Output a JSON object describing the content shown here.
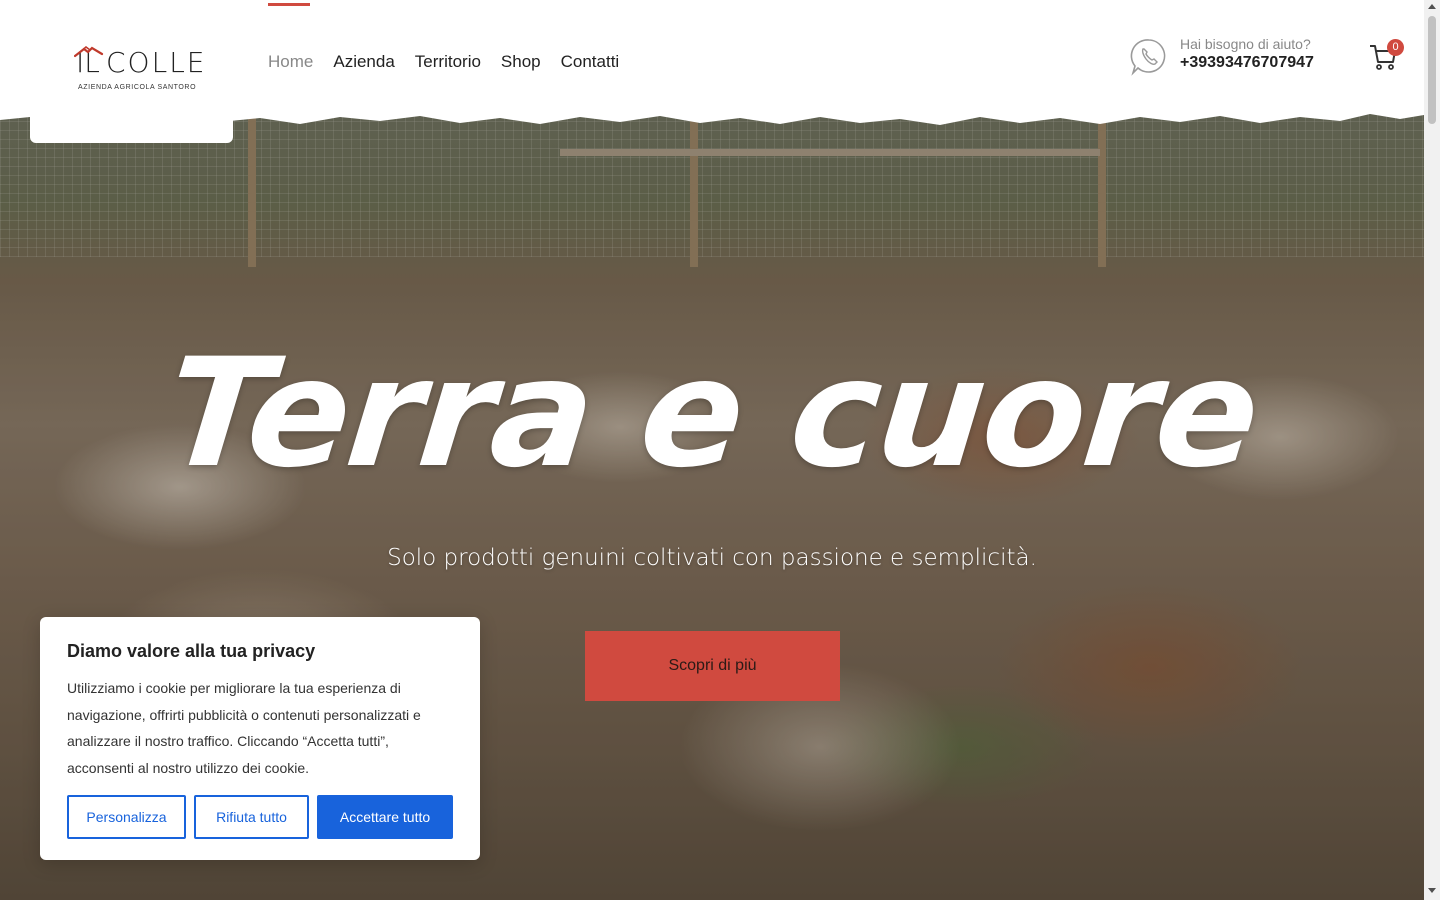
{
  "brand": {
    "name_left": "IL",
    "name_right": "COLLE",
    "tagline": "AZIENDA AGRICOLA SANTORO"
  },
  "nav": {
    "items": [
      {
        "label": "Home",
        "active": true
      },
      {
        "label": "Azienda",
        "active": false
      },
      {
        "label": "Territorio",
        "active": false
      },
      {
        "label": "Shop",
        "active": false
      },
      {
        "label": "Contatti",
        "active": false
      }
    ]
  },
  "help": {
    "title": "Hai bisogno di aiuto?",
    "phone": "+39393476707947",
    "icon": "whatsapp-icon"
  },
  "cart": {
    "icon": "cart-icon",
    "count": "0"
  },
  "hero": {
    "title": "Terra e cuore",
    "subtitle": "Solo prodotti genuini coltivati con passione e semplicità.",
    "button_label": "Scopri di più"
  },
  "cookie": {
    "title": "Diamo valore alla tua privacy",
    "text": "Utilizziamo i cookie per migliorare la tua esperienza di navigazione, offrirti pubblicità o contenuti personalizzati e analizzare il nostro traffico. Cliccando “Accetta tutti”, acconsenti al nostro utilizzo dei cookie.",
    "buttons": {
      "customize": "Personalizza",
      "reject": "Rifiuta tutto",
      "accept": "Accettare tutto"
    }
  },
  "colors": {
    "accent": "#d04a3f",
    "cookie_blue": "#1863dc",
    "text_dark": "#222222"
  }
}
